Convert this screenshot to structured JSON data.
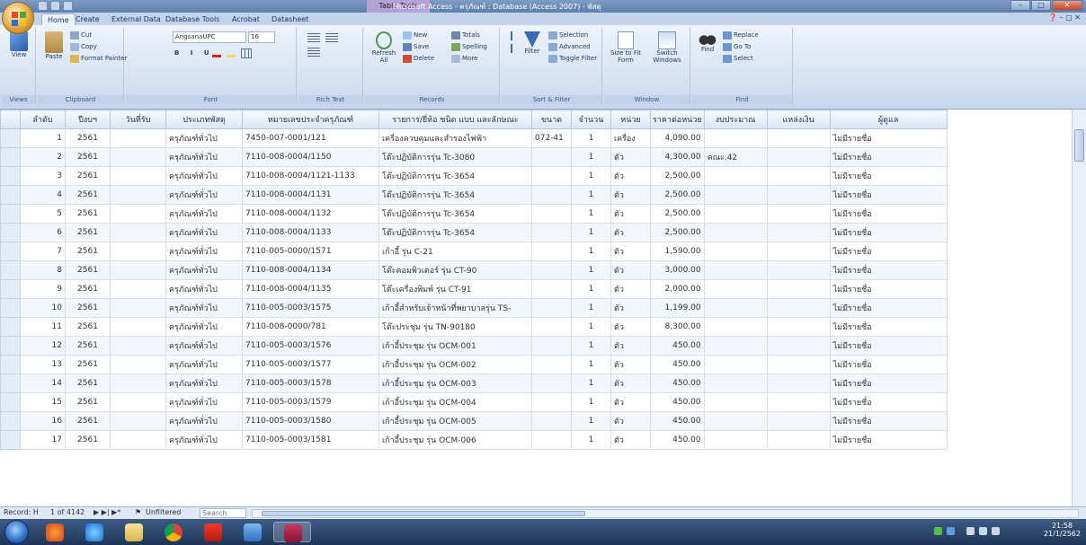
{
  "window": {
    "title": "Microsoft Access - ครุภัณฑ์ : Database (Access 2007) - พัสดุ",
    "context_tab": "Table Tools",
    "controls": [
      "–",
      "□",
      "✕"
    ]
  },
  "ribbon_tabs": [
    "Home",
    "Create",
    "External Data",
    "Database Tools",
    "Acrobat",
    "Datasheet"
  ],
  "ribbon": {
    "views": {
      "view_label": "View",
      "group": "Views"
    },
    "clipboard": {
      "paste_label": "Paste",
      "cut_label": "Cut",
      "copy_label": "Copy",
      "format_painter_label": "Format Painter",
      "group": "Clipboard"
    },
    "font": {
      "font_name": "AngsanaUPC",
      "font_size": "16",
      "group": "Font"
    },
    "rich_text": {
      "group": "Rich Text"
    },
    "records": {
      "refresh_label": "Refresh All",
      "new_label": "New",
      "save_label": "Save",
      "delete_label": "Delete",
      "totals_label": "Totals",
      "spelling_label": "Spelling",
      "more_label": "More",
      "group": "Records"
    },
    "sort_filter": {
      "filter_label": "Filter",
      "selection_label": "Selection",
      "advanced_label": "Advanced",
      "toggle_label": "Toggle Filter",
      "group": "Sort & Filter"
    },
    "window": {
      "size_label": "Size to Fit Form",
      "switch_label": "Switch Windows",
      "group": "Window"
    },
    "find": {
      "find_label": "Find",
      "replace_label": "Replace",
      "goto_label": "Go To",
      "select_label": "Select",
      "group": "Find"
    }
  },
  "table": {
    "columns": [
      "ลำดับ",
      "ปีงบฯ",
      "วันที่รับ",
      "ประเภทพัสดุ",
      "หมายเลขประจำครุภัณฑ์",
      "รายการ/ยี่ห้อ ชนิด แบบ และลักษณะ",
      "ขนาด",
      "จำนวน",
      "หน่วย",
      "ราคาต่อหน่วย",
      "งบประมาณ",
      "แหล่งเงิน",
      "ผู้ดูแล"
    ],
    "rows": [
      [
        "1",
        "2561",
        "",
        "ครุภัณฑ์ทั่วไป",
        "7450-007-0001/121",
        "เครื่องควบคุมและสำรองไฟฟ้า",
        "072-41",
        "1",
        "เครื่อง",
        "4,090.00",
        "",
        "",
        "ไม่มีรายชื่อ"
      ],
      [
        "2",
        "2561",
        "",
        "ครุภัณฑ์ทั่วไป",
        "7110-008-0004/1150",
        "โต๊ะปฏิบัติการรุ่น Tc-3080",
        "",
        "1",
        "ตัว",
        "4,300.00",
        "คณะ.42",
        "",
        "ไม่มีรายชื่อ"
      ],
      [
        "3",
        "2561",
        "",
        "ครุภัณฑ์ทั่วไป",
        "7110-008-0004/1121-1133",
        "โต๊ะปฏิบัติการรุ่น Tc-3654",
        "",
        "1",
        "ตัว",
        "2,500.00",
        "",
        "",
        "ไม่มีรายชื่อ"
      ],
      [
        "4",
        "2561",
        "",
        "ครุภัณฑ์ทั่วไป",
        "7110-008-0004/1131",
        "โต๊ะปฏิบัติการรุ่น Tc-3654",
        "",
        "1",
        "ตัว",
        "2,500.00",
        "",
        "",
        "ไม่มีรายชื่อ"
      ],
      [
        "5",
        "2561",
        "",
        "ครุภัณฑ์ทั่วไป",
        "7110-008-0004/1132",
        "โต๊ะปฏิบัติการรุ่น Tc-3654",
        "",
        "1",
        "ตัว",
        "2,500.00",
        "",
        "",
        "ไม่มีรายชื่อ"
      ],
      [
        "6",
        "2561",
        "",
        "ครุภัณฑ์ทั่วไป",
        "7110-008-0004/1133",
        "โต๊ะปฏิบัติการรุ่น Tc-3654",
        "",
        "1",
        "ตัว",
        "2,500.00",
        "",
        "",
        "ไม่มีรายชื่อ"
      ],
      [
        "7",
        "2561",
        "",
        "ครุภัณฑ์ทั่วไป",
        "7110-005-0000/1571",
        "เก้าอี้ รุ่น C-21",
        "",
        "1",
        "ตัว",
        "1,590.00",
        "",
        "",
        "ไม่มีรายชื่อ"
      ],
      [
        "8",
        "2561",
        "",
        "ครุภัณฑ์ทั่วไป",
        "7110-008-0004/1134",
        "โต๊ะคอมพิวเตอร์ รุ่น CT-90",
        "",
        "1",
        "ตัว",
        "3,000.00",
        "",
        "",
        "ไม่มีรายชื่อ"
      ],
      [
        "9",
        "2561",
        "",
        "ครุภัณฑ์ทั่วไป",
        "7110-008-0004/1135",
        "โต๊ะเครื่องพิมพ์ รุ่น CT-91",
        "",
        "1",
        "ตัว",
        "2,000.00",
        "",
        "",
        "ไม่มีรายชื่อ"
      ],
      [
        "10",
        "2561",
        "",
        "ครุภัณฑ์ทั่วไป",
        "7110-005-0003/1575",
        "เก้าอี้สำหรับเจ้าหน้าที่พยาบาลรุ่น TS-",
        "",
        "1",
        "ตัว",
        "1,199.00",
        "",
        "",
        "ไม่มีรายชื่อ"
      ],
      [
        "11",
        "2561",
        "",
        "ครุภัณฑ์ทั่วไป",
        "7110-008-0000/781",
        "โต๊ะประชุม รุ่น TN-90180",
        "",
        "1",
        "ตัว",
        "8,300.00",
        "",
        "",
        "ไม่มีรายชื่อ"
      ],
      [
        "12",
        "2561",
        "",
        "ครุภัณฑ์ทั่วไป",
        "7110-005-0003/1576",
        "เก้าอี้ประชุม รุ่น OCM-001",
        "",
        "1",
        "ตัว",
        "450.00",
        "",
        "",
        "ไม่มีรายชื่อ"
      ],
      [
        "13",
        "2561",
        "",
        "ครุภัณฑ์ทั่วไป",
        "7110-005-0003/1577",
        "เก้าอี้ประชุม รุ่น OCM-002",
        "",
        "1",
        "ตัว",
        "450.00",
        "",
        "",
        "ไม่มีรายชื่อ"
      ],
      [
        "14",
        "2561",
        "",
        "ครุภัณฑ์ทั่วไป",
        "7110-005-0003/1578",
        "เก้าอี้ประชุม รุ่น OCM-003",
        "",
        "1",
        "ตัว",
        "450.00",
        "",
        "",
        "ไม่มีรายชื่อ"
      ],
      [
        "15",
        "2561",
        "",
        "ครุภัณฑ์ทั่วไป",
        "7110-005-0003/1579",
        "เก้าอี้ประชุม รุ่น OCM-004",
        "",
        "1",
        "ตัว",
        "450.00",
        "",
        "",
        "ไม่มีรายชื่อ"
      ],
      [
        "16",
        "2561",
        "",
        "ครุภัณฑ์ทั่วไป",
        "7110-005-0003/1580",
        "เก้าอี้ประชุม รุ่น OCM-005",
        "",
        "1",
        "ตัว",
        "450.00",
        "",
        "",
        "ไม่มีรายชื่อ"
      ],
      [
        "17",
        "2561",
        "",
        "ครุภัณฑ์ทั่วไป",
        "7110-005-0003/1581",
        "เก้าอี้ประชุม รุ่น OCM-006",
        "",
        "1",
        "ตัว",
        "450.00",
        "",
        "",
        "ไม่มีรายชื่อ"
      ]
    ]
  },
  "record_nav": {
    "label": "Record: H",
    "position": "1 of 4142",
    "filter_label": "Unfiltered",
    "search_placeholder": "Search"
  },
  "taskbar": {
    "time": "21:58",
    "date": "21/1/2562"
  }
}
